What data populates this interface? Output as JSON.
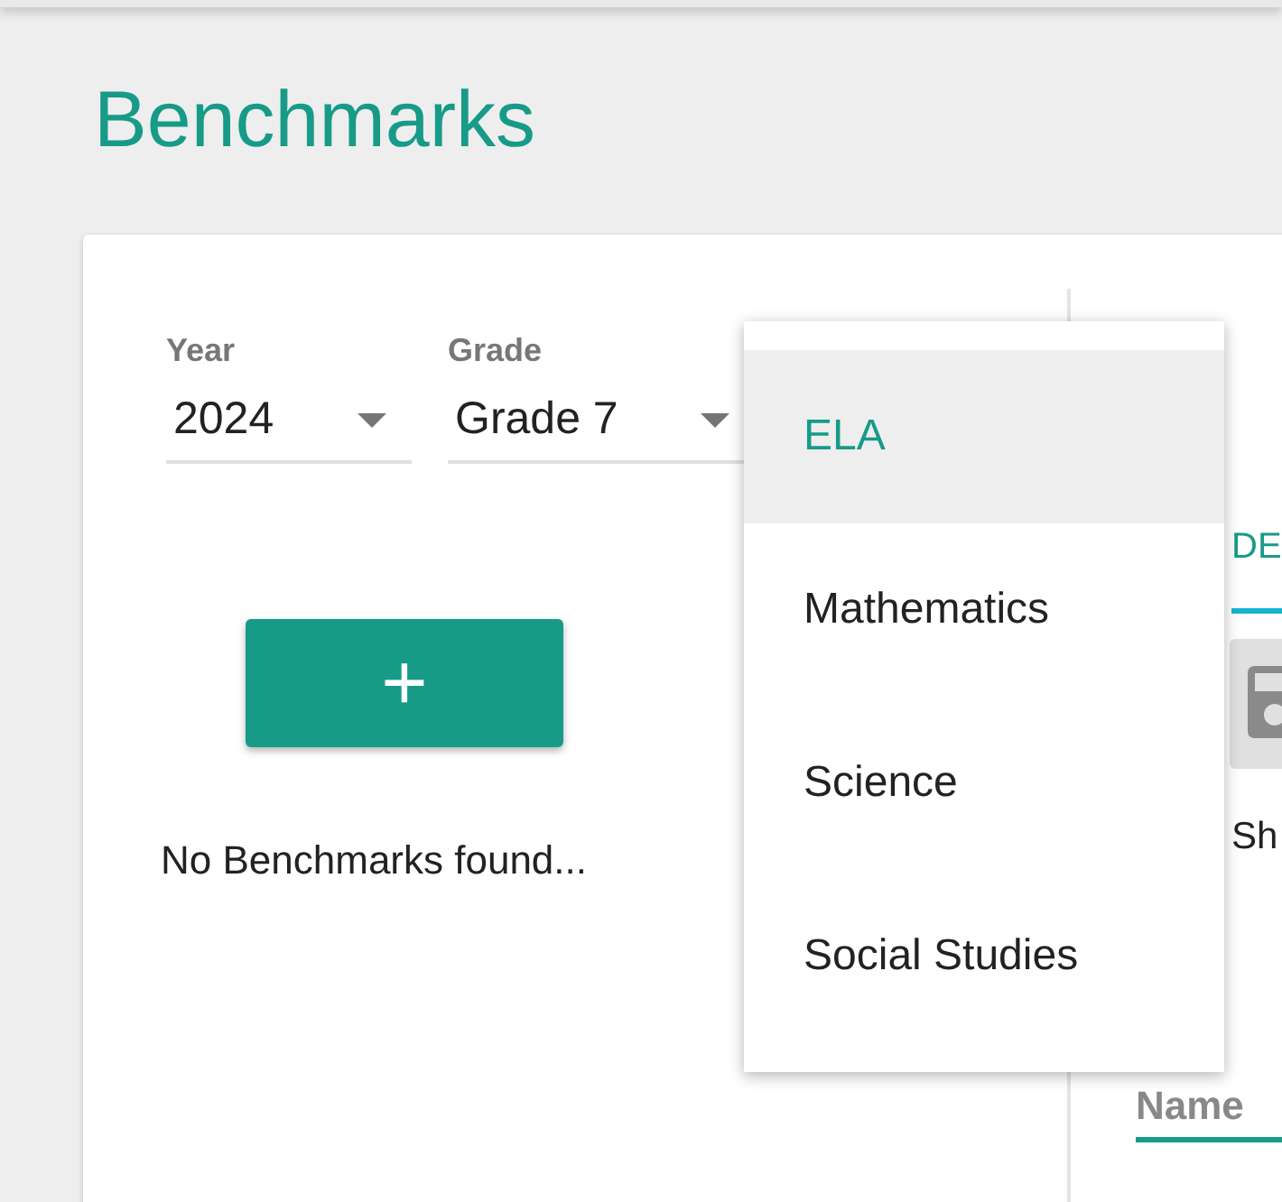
{
  "page_title": "Benchmarks",
  "filters": [
    {
      "label": "Year",
      "value": "2024"
    },
    {
      "label": "Grade",
      "value": "Grade 7"
    }
  ],
  "add_button": "+",
  "empty_message": "No Benchmarks found...",
  "right_panel": {
    "tab": {
      "label": "DE",
      "selected": true
    },
    "save_disabled": true,
    "text": "Sh",
    "field_label": "Name"
  },
  "dropdown_menu": [
    {
      "label": "ELA",
      "selected": true
    },
    {
      "label": "Mathematics",
      "selected": false
    },
    {
      "label": "Science",
      "selected": false
    },
    {
      "label": "Social Studies",
      "selected": false
    }
  ]
}
